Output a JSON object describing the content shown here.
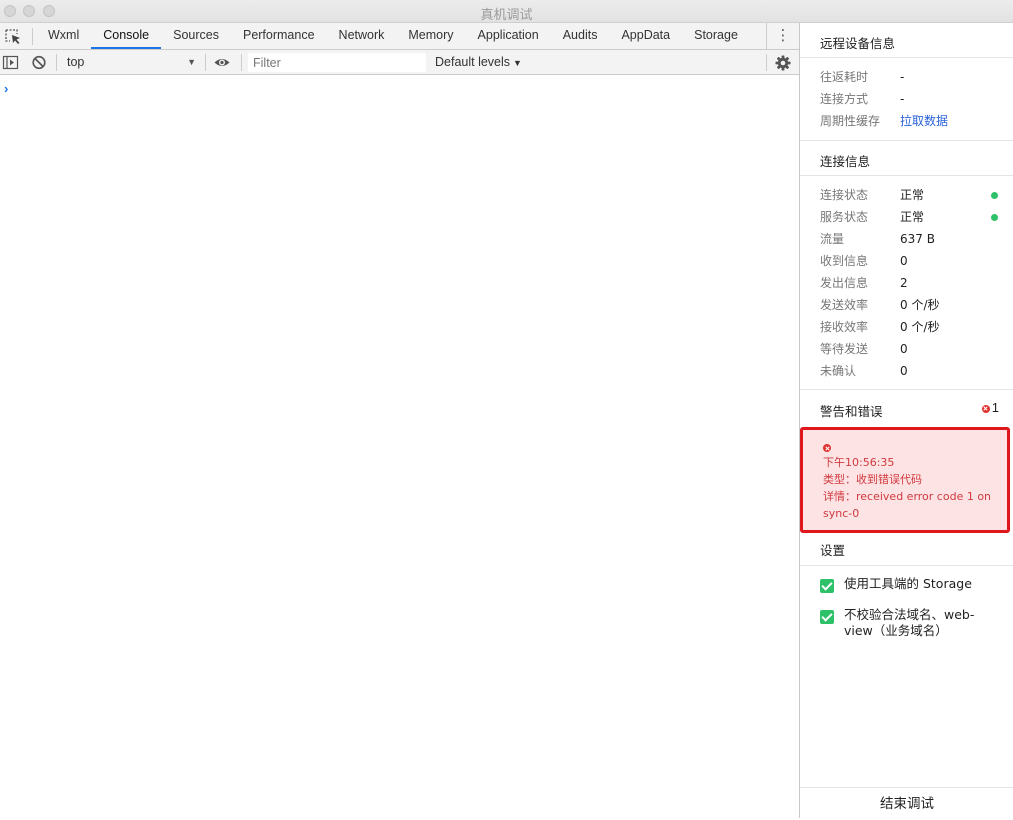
{
  "window": {
    "title": "真机调试"
  },
  "tabs": [
    "Wxml",
    "Console",
    "Sources",
    "Performance",
    "Network",
    "Memory",
    "Application",
    "Audits",
    "AppData",
    "Storage"
  ],
  "active_tab": "Console",
  "toolbar": {
    "context": "top",
    "filter_placeholder": "Filter",
    "levels_label": "Default levels"
  },
  "console": {
    "prompt": "›"
  },
  "remote_device": {
    "heading": "远程设备信息",
    "rows": [
      {
        "label": "往返耗时",
        "value": "-"
      },
      {
        "label": "连接方式",
        "value": "-"
      },
      {
        "label": "周期性缓存",
        "value": "拉取数据"
      }
    ]
  },
  "connection": {
    "heading": "连接信息",
    "rows": [
      {
        "label": "连接状态",
        "value": "正常"
      },
      {
        "label": "服务状态",
        "value": "正常"
      },
      {
        "label": "流量",
        "value": "637 B"
      },
      {
        "label": "收到信息",
        "value": "0"
      },
      {
        "label": "发出信息",
        "value": "2"
      },
      {
        "label": "发送效率",
        "value": "0 个/秒"
      },
      {
        "label": "接收效率",
        "value": "0 个/秒"
      },
      {
        "label": "等待发送",
        "value": "0"
      },
      {
        "label": "未确认",
        "value": "0"
      }
    ],
    "status_color": "#2dc16a"
  },
  "warnings": {
    "heading": "警告和错误",
    "count": "1",
    "error": {
      "time": "下午10:56:35",
      "type": "类型：收到错误代码",
      "detail_line1": "详情：received error code 1 on",
      "detail_line2": "sync-0"
    }
  },
  "settings": {
    "heading": "设置",
    "options": [
      {
        "label": "使用工具端的 Storage",
        "checked": true
      },
      {
        "label": "不校验合法域名、web-view（业务域名）",
        "checked": true
      }
    ]
  },
  "end_button": "结束调试"
}
